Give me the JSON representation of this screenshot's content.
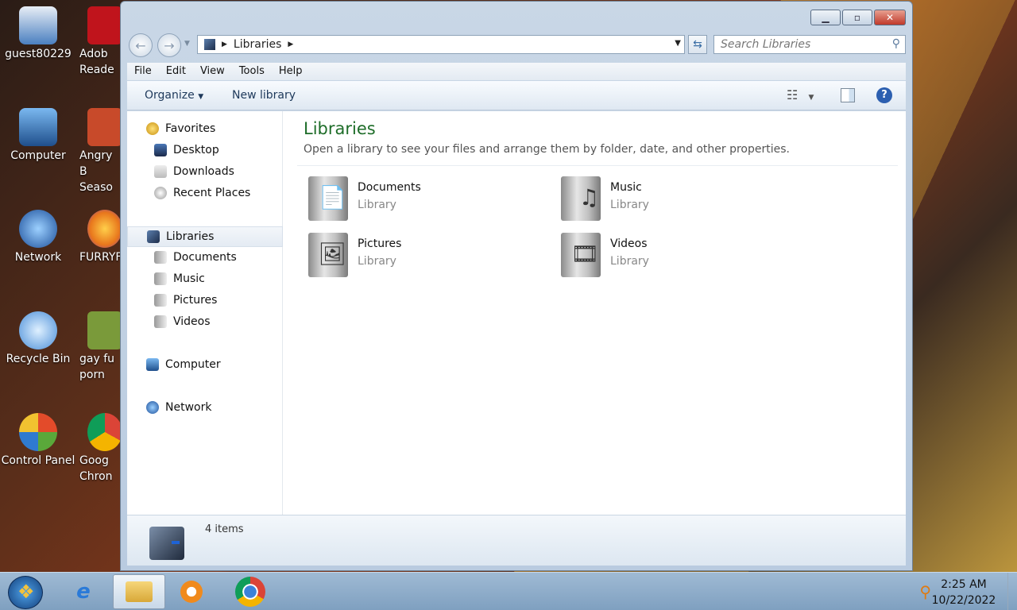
{
  "desktop": {
    "icons": [
      {
        "label": "guest80229",
        "color": "#4a7fc0"
      },
      {
        "label": "Computer",
        "color": "#2f6fb8"
      },
      {
        "label": "Network",
        "color": "#3b8ede"
      },
      {
        "label": "Recycle Bin",
        "color": "#6aaae8"
      },
      {
        "label": "Control Panel",
        "color": "#d03a2a"
      }
    ],
    "icons_col2": [
      {
        "label": "Adob Reade",
        "color": "#c0141c"
      },
      {
        "label": "Angry B Seaso",
        "color": "#c84a2a"
      },
      {
        "label": "FURRYFU",
        "color": "#e8761c"
      },
      {
        "label": "gay fu porn",
        "color": "#7a9a3a"
      },
      {
        "label": "Goog Chron",
        "color": "#3b82d8"
      }
    ]
  },
  "window": {
    "address": {
      "crumb": "Libraries"
    },
    "search_placeholder": "Search Libraries",
    "menu": [
      "File",
      "Edit",
      "View",
      "Tools",
      "Help"
    ],
    "toolbar": {
      "organize": "Organize",
      "new_library": "New library"
    },
    "nav": {
      "favorites": "Favorites",
      "desktop": "Desktop",
      "downloads": "Downloads",
      "recent": "Recent Places",
      "libraries": "Libraries",
      "documents": "Documents",
      "music": "Music",
      "pictures": "Pictures",
      "videos": "Videos",
      "computer": "Computer",
      "network": "Network"
    },
    "header": {
      "title": "Libraries",
      "subtitle": "Open a library to see your files and arrange them by folder, date, and other properties."
    },
    "libraries": [
      {
        "name": "Documents",
        "type": "Library",
        "glyph": "📄"
      },
      {
        "name": "Music",
        "type": "Library",
        "glyph": "♫"
      },
      {
        "name": "Pictures",
        "type": "Library",
        "glyph": "🖼"
      },
      {
        "name": "Videos",
        "type": "Library",
        "glyph": "🎞"
      }
    ],
    "details": {
      "count": "4 items"
    }
  },
  "taskbar": {
    "time": "2:25 AM",
    "date": "10/22/2022"
  }
}
